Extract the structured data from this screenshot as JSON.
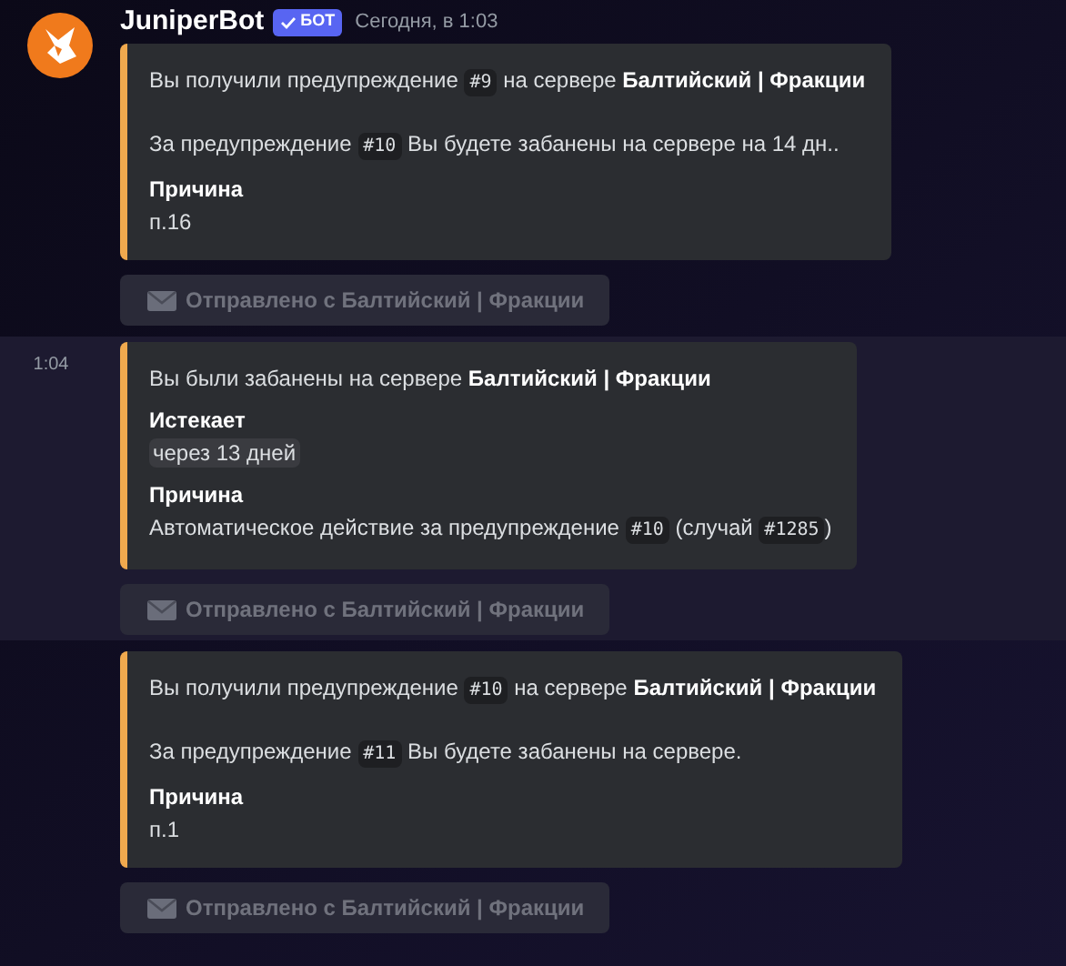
{
  "author": {
    "name": "JuniperBot",
    "badge": "БОТ",
    "timestamp": "Сегодня, в 1:03"
  },
  "messages": [
    {
      "highlighted": false,
      "embed": {
        "description": [
          [
            {
              "kind": "text",
              "text": "Вы получили предупреждение "
            },
            {
              "kind": "code",
              "text": "#9"
            },
            {
              "kind": "text",
              "text": " на сервере "
            },
            {
              "kind": "bold",
              "text": "Балтийский | Фракции"
            }
          ],
          [
            {
              "kind": "text",
              "text": "За предупреждение "
            },
            {
              "kind": "code",
              "text": "#10"
            },
            {
              "kind": "text",
              "text": " Вы будете забанены на сервере на 14 дн.."
            }
          ]
        ],
        "fields": [
          {
            "name": "Причина",
            "value": [
              {
                "kind": "text",
                "text": "п.16"
              }
            ]
          }
        ]
      },
      "button": {
        "label": "Отправлено с Балтийский | Фракции",
        "disabled": true
      }
    },
    {
      "highlighted": true,
      "time": "1:04",
      "embed": {
        "description": [
          [
            {
              "kind": "text",
              "text": "Вы были забанены на сервере "
            },
            {
              "kind": "bold",
              "text": "Балтийский | Фракции"
            }
          ]
        ],
        "fields": [
          {
            "name": "Истекает",
            "value": [
              {
                "kind": "timestamp",
                "text": "через 13 дней"
              }
            ]
          },
          {
            "name": "Причина",
            "value": [
              {
                "kind": "text",
                "text": "Автоматическое действие за предупреждение "
              },
              {
                "kind": "code",
                "text": "#10"
              },
              {
                "kind": "text",
                "text": " (случай "
              },
              {
                "kind": "code",
                "text": "#1285"
              },
              {
                "kind": "text",
                "text": ")"
              }
            ]
          }
        ]
      },
      "button": {
        "label": "Отправлено с Балтийский | Фракции",
        "disabled": true
      }
    },
    {
      "highlighted": false,
      "embed": {
        "description": [
          [
            {
              "kind": "text",
              "text": "Вы получили предупреждение "
            },
            {
              "kind": "code",
              "text": "#10"
            },
            {
              "kind": "text",
              "text": " на сервере "
            },
            {
              "kind": "bold",
              "text": "Балтийский | Фракции"
            }
          ],
          [
            {
              "kind": "text",
              "text": "За предупреждение "
            },
            {
              "kind": "code",
              "text": "#11"
            },
            {
              "kind": "text",
              "text": " Вы будете забанены на сервере."
            }
          ]
        ],
        "fields": [
          {
            "name": "Причина",
            "value": [
              {
                "kind": "text",
                "text": "п.1"
              }
            ]
          }
        ]
      },
      "button": {
        "label": "Отправлено с Балтийский | Фракции",
        "disabled": true
      }
    }
  ]
}
